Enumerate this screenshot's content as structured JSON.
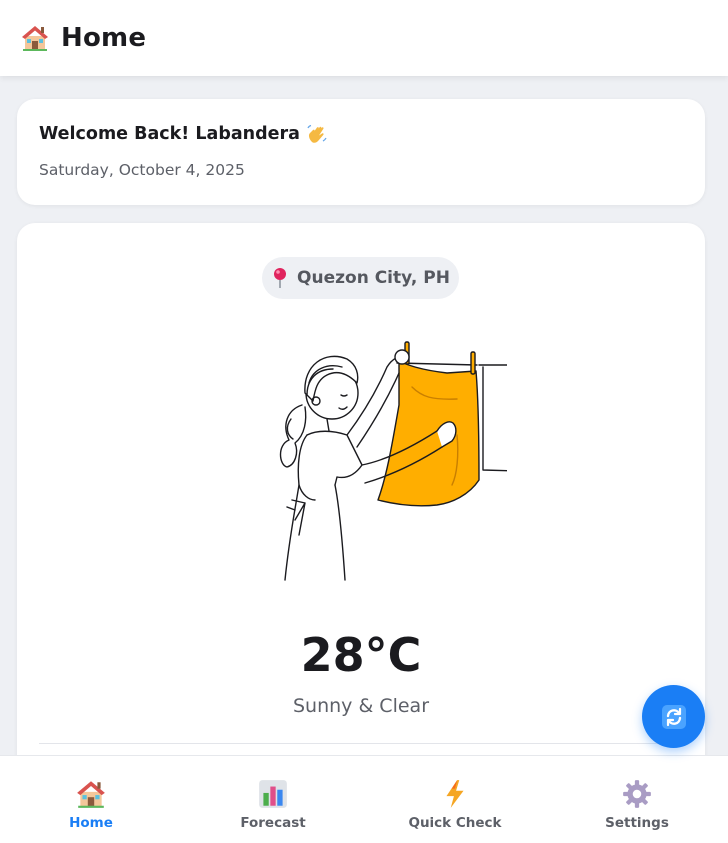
{
  "header": {
    "title": "Home",
    "icon": "house-icon"
  },
  "welcome": {
    "title": "Welcome Back! Labandera",
    "wave_icon": "waving-hand-icon",
    "date": "Saturday, October 4, 2025"
  },
  "weather": {
    "location": "Quezon City, PH",
    "location_icon": "pin-icon",
    "temperature": "28°C",
    "condition": "Sunny & Clear",
    "illustration": "woman-hanging-laundry-illustration"
  },
  "fab": {
    "icon": "refresh-icon"
  },
  "nav": {
    "items": [
      {
        "label": "Home",
        "icon": "house-icon",
        "active": true
      },
      {
        "label": "Forecast",
        "icon": "bar-chart-icon",
        "active": false
      },
      {
        "label": "Quick Check",
        "icon": "lightning-icon",
        "active": false
      },
      {
        "label": "Settings",
        "icon": "gear-icon",
        "active": false
      }
    ]
  },
  "colors": {
    "accent": "#1a7ef5",
    "background": "#eef0f4",
    "card": "#ffffff",
    "laundry": "#ffae00"
  }
}
